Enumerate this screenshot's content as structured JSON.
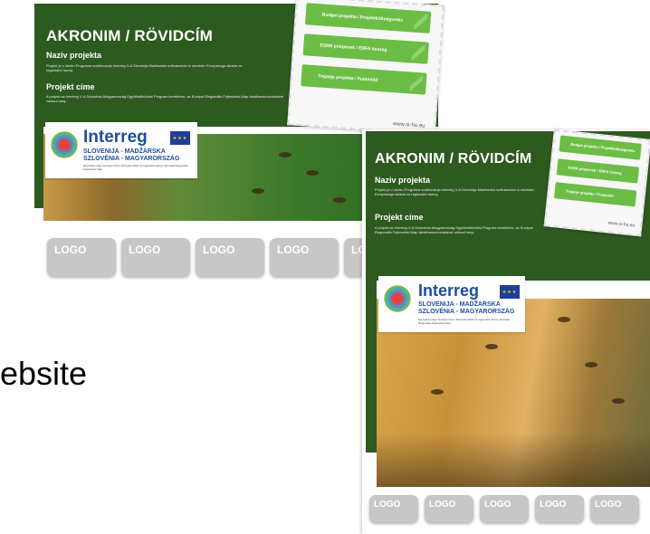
{
  "left_page": {
    "title": "AKRONIM / RÖVIDCÍM",
    "naziv_label": "Naziv projekta",
    "naziv_text": "Projekt je v okviru Programa sodelovanja Interreg V-A Slovenija-Madžarska sofinanciran iz sredstev Evropskega sklada za regionalni razvoj.",
    "cime_label": "Projekt címe",
    "cime_text": "A projekt az Interreg V-A Szlovénia-Magyarország Együttműködési Program keretében, az Európai Regionális Fejlesztési Alap társfinanszírozásával valósul meg.",
    "stamp_rows": [
      "Budget projekta / Projektköltségvetés",
      "ESRR prispevek / ERFA összeg",
      "Trajanje projekta / Futamidő"
    ],
    "stamp_url": "www.si-hu.eu",
    "logos": [
      "LOGO",
      "LOGO",
      "LOGO",
      "LOGO",
      "LO"
    ]
  },
  "right_page": {
    "title": "AKRONIM / RÖVIDCÍM",
    "naziv_label": "Naziv projekta",
    "naziv_text": "Projekt je v okviru Programa sodelovanja Interreg V-A Slovenija-Madžarska sofinanciran iz sredstev Evropskega sklada za regionalni razvoj.",
    "cime_label": "Projekt címe",
    "cime_text": "A projekt az Interreg V-A Szlovénia-Magyarország Együttműködési Program keretében, az Európai Regionális Fejlesztési Alap társfinanszírozásával valósul meg.",
    "stamp_rows": [
      "Budget projekta / Projektköltségvetés",
      "ESRR prispevek / ERFA összeg",
      "Trajanje projekta / Futamidő"
    ],
    "stamp_url": "www.si-hu.eu",
    "logos": [
      "LOGO",
      "LOGO",
      "LOGO",
      "LOGO",
      "LOGO"
    ]
  },
  "interreg": {
    "word": "Interreg",
    "line1": "SLOVENIJA - MADŽARSKA",
    "line2": "SZLOVÉNIA - MAGYARORSZÁG",
    "fine": "Evropska unija | Európai Unió | Evropski sklad za regionalni razvoj | Európai Regionális Fejlesztési Alap"
  },
  "caption": "ebsite",
  "colors": {
    "green": "#2d5a1f",
    "stamp_green": "#6bbd45",
    "logo_gray": "#c7c7c7",
    "interreg_blue": "#1e4f9c"
  }
}
